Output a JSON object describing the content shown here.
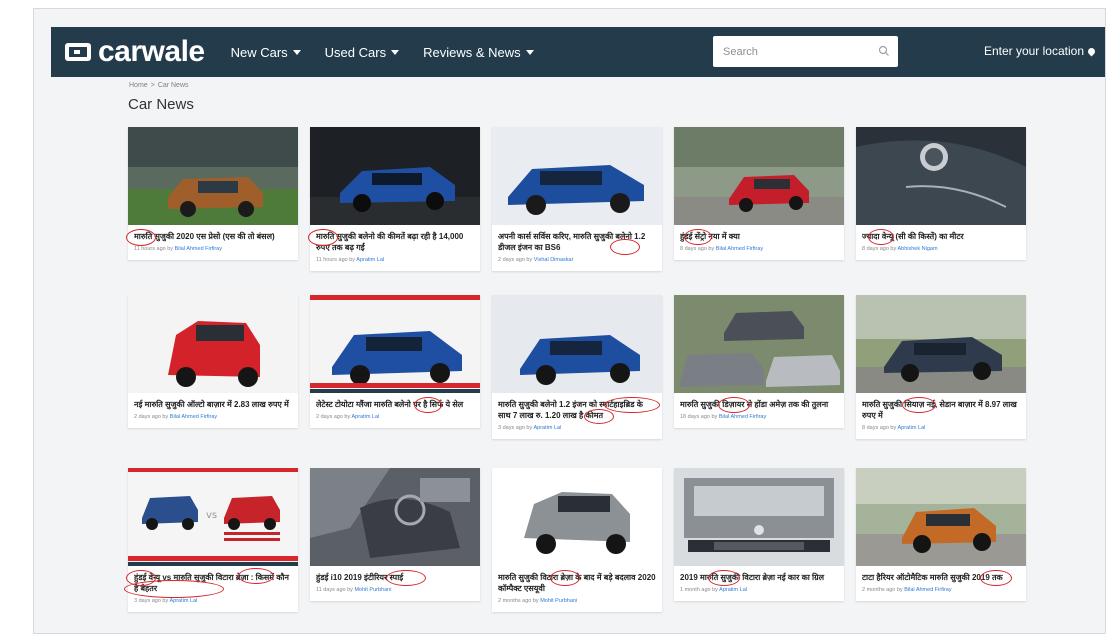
{
  "header": {
    "logo": "carwale",
    "nav": [
      {
        "label": "New Cars"
      },
      {
        "label": "Used Cars"
      },
      {
        "label": "Reviews & News"
      }
    ],
    "search_placeholder": "Search",
    "location_label": "Enter your location"
  },
  "breadcrumb": {
    "home": "Home",
    "separator": ">",
    "current": "Car News"
  },
  "page_title": "Car News",
  "articles": [
    {
      "title": "मारुति सुजुकी 2020 एस प्रेसो (एस की तो बंसल)",
      "meta": "11 hours ago by",
      "author": "Bilal Ahmed Firfiray"
    },
    {
      "title": "मारुति सुजुकी बलेनो की कीमतें बढ़ा रही है 14,000 रुपए तक बढ़ गईं",
      "meta": "11 hours ago by",
      "author": "Apratim Lal"
    },
    {
      "title": "अपनी कार्स सर्विस करिए, मारुति सुजुकी बलेनो 1.2 डीजल इंजन का BS6",
      "meta": "2 days ago by",
      "author": "Vishal Dimaskar"
    },
    {
      "title": "हुंडई सेंट्रो नया में क्या",
      "meta": "8 days ago by",
      "author": "Bilal Ahmed Firfiray"
    },
    {
      "title": "ज्यादा वेन्यू (सी की किस्तें) का मीटर",
      "meta": "8 days ago by",
      "author": "Abhishek Nigam"
    },
    {
      "title": "नई मारुति सुजुकी ऑल्टो बाज़ार में 2.83 लाख रुपए में",
      "meta": "2 days ago by",
      "author": "Bilal Ahmed Firfiray"
    },
    {
      "title": "लेटेस्ट टोयोटा ग्लैंजा मारुति बलेनो पर है सिर्फ ये सेल",
      "meta": "2 days ago by",
      "author": "Apratim Lal"
    },
    {
      "title": "मारुति सुजुकी बलेनो 1.2 इंजन को स्मार्टहाइब्रिड के साथ 7 लाख रु. 1.20 लाख है कीमत",
      "meta": "3 days ago by",
      "author": "Apratim Lal"
    },
    {
      "title": "मारुति सुजुकी डिज़ायर से होंडा अमेज़ तक की तुलना",
      "meta": "18 days ago by",
      "author": "Bilal Ahmed Firfiray"
    },
    {
      "title": "मारुति सुजुकी सियाज़ नई, सेडान बाज़ार में 8.97 लाख रुपए में",
      "meta": "8 days ago by",
      "author": "Apratim Lal"
    },
    {
      "title": "हुंडई वेन्यू vs मारुति सुजुकी विटारा ब्रेज़ा : किसमें कौन है बेहतर",
      "meta": "3 days ago by",
      "author": "Apratim Lal"
    },
    {
      "title": "हुंडई i10 2019 इंटीरियर स्पाई",
      "meta": "11 days ago by",
      "author": "Mohit Purbhani"
    },
    {
      "title": "मारुति सुजुकी विटारा ब्रेज़ा के बाद में बड़े बदलाव 2020 कॉम्पैक्ट एसयूवी",
      "meta": "2 months ago by",
      "author": "Mohit Purbhani"
    },
    {
      "title": "2019 मारुति सुजुकी विटारा ब्रेज़ा नई कार का ग्रिल",
      "meta": "1 month ago by",
      "author": "Apratim Lal"
    },
    {
      "title": "टाटा हैरियर ऑटोमैटिक मारुति सुजुकी 2019 तक",
      "meta": "2 months ago by",
      "author": "Bilal Ahmed Firfiray"
    }
  ]
}
